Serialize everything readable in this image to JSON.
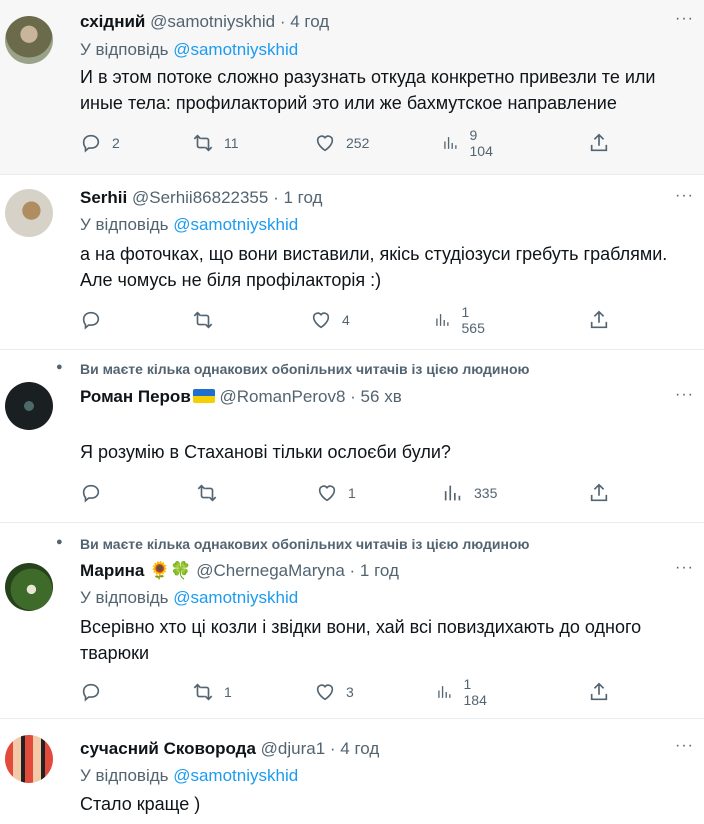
{
  "tweets": [
    {
      "name": "східний",
      "handle": "@samotniyskhid",
      "time": "· 4 год",
      "reply_prefix": "У відповідь ",
      "reply_to": "@samotniyskhid",
      "text": "И в этом потоке сложно разузнать откуда конкретно привезли те или иные тела: профилакторий это или же бахмутское направление",
      "replies": "2",
      "retweets": "11",
      "likes": "252",
      "views": "9 104"
    },
    {
      "name": "Serhii",
      "handle": "@Serhii86822355",
      "time": "· 1 год",
      "reply_prefix": "У відповідь ",
      "reply_to": "@samotniyskhid",
      "text": "а на фоточках, що вони виставили, якісь студіозуси гребуть граблями. Але чомусь не біля профілакторія :)",
      "replies": "",
      "retweets": "",
      "likes": "4",
      "views": "1 565"
    },
    {
      "social": "Ви маєте кілька однакових обопільних читачів із цією людиною",
      "name": "Роман Перов",
      "handle": "@RomanPerov8",
      "time": "· 56 хв",
      "text": "Я розумію в Стаханові тільки ослоєби були?",
      "replies": "",
      "retweets": "",
      "likes": "1",
      "views": "335"
    },
    {
      "social": "Ви маєте кілька однакових обопільних читачів із цією людиною",
      "name": "Марина",
      "name_emoji": "🌻🍀",
      "handle": "@ChernegaMaryna",
      "time": "· 1 год",
      "reply_prefix": "У відповідь ",
      "reply_to": "@samotniyskhid",
      "text": "Всерівно хто ці козли і звідки вони, хай всі повиздихають до одного тварюки",
      "replies": "",
      "retweets": "1",
      "likes": "3",
      "views": "1 184"
    },
    {
      "name": "сучасний Сковорода",
      "handle": "@djura1",
      "time": "· 4 год",
      "reply_prefix": "У відповідь ",
      "reply_to": "@samotniyskhid",
      "text": "Стало краще )"
    }
  ],
  "more_label": "···",
  "icons": {
    "reply": "reply-icon",
    "retweet": "retweet-icon",
    "like": "heart-icon",
    "views": "views-icon",
    "share": "share-icon",
    "more": "more-icon",
    "social": "person-icon"
  },
  "colors": {
    "accent": "#1d9bf0",
    "secondary": "#536471",
    "highlight_bg": "#f7f7f7"
  }
}
